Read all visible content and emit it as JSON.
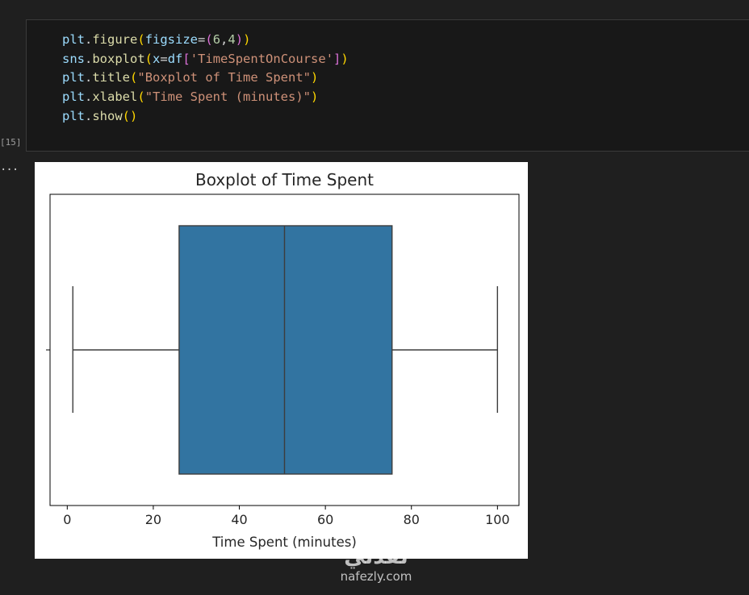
{
  "code_cell": {
    "execution_count": "[15]",
    "lines": {
      "l1": {
        "a": "plt",
        "b": ".",
        "c": "figure",
        "d": "(",
        "e": "figsize",
        "f": "=",
        "g": "(",
        "h": "6",
        "i": ",",
        "j": "4",
        "k": ")",
        "l": ")"
      },
      "l2": {
        "a": "sns",
        "b": ".",
        "c": "boxplot",
        "d": "(",
        "e": "x",
        "f": "=",
        "g": "df",
        "h": "[",
        "i": "'TimeSpentOnCourse'",
        "j": "]",
        "k": ")"
      },
      "l3": {
        "a": "plt",
        "b": ".",
        "c": "title",
        "d": "(",
        "e": "\"Boxplot of Time Spent\"",
        "f": ")"
      },
      "l4": {
        "a": "plt",
        "b": ".",
        "c": "xlabel",
        "d": "(",
        "e": "\"Time Spent (minutes)\"",
        "f": ")"
      },
      "l5": {
        "a": "plt",
        "b": ".",
        "c": "show",
        "d": "(",
        "e": ")"
      }
    }
  },
  "output": {
    "ellipsis": "..."
  },
  "chart_data": {
    "type": "boxplot",
    "title": "Boxplot of Time Spent",
    "xlabel": "Time Spent (minutes)",
    "ylabel": "",
    "xlim": [
      -4,
      105
    ],
    "xticks": [
      0,
      20,
      40,
      60,
      80,
      100
    ],
    "box": {
      "whisker_low": 1.3,
      "q1": 26,
      "median": 50.5,
      "q3": 75.5,
      "whisker_high": 100
    },
    "box_color": "#3274a1",
    "line_color": "#3d3d3d",
    "grid": false
  },
  "watermark": {
    "arabic": "نفذلي",
    "latin": "nafezly.com"
  }
}
